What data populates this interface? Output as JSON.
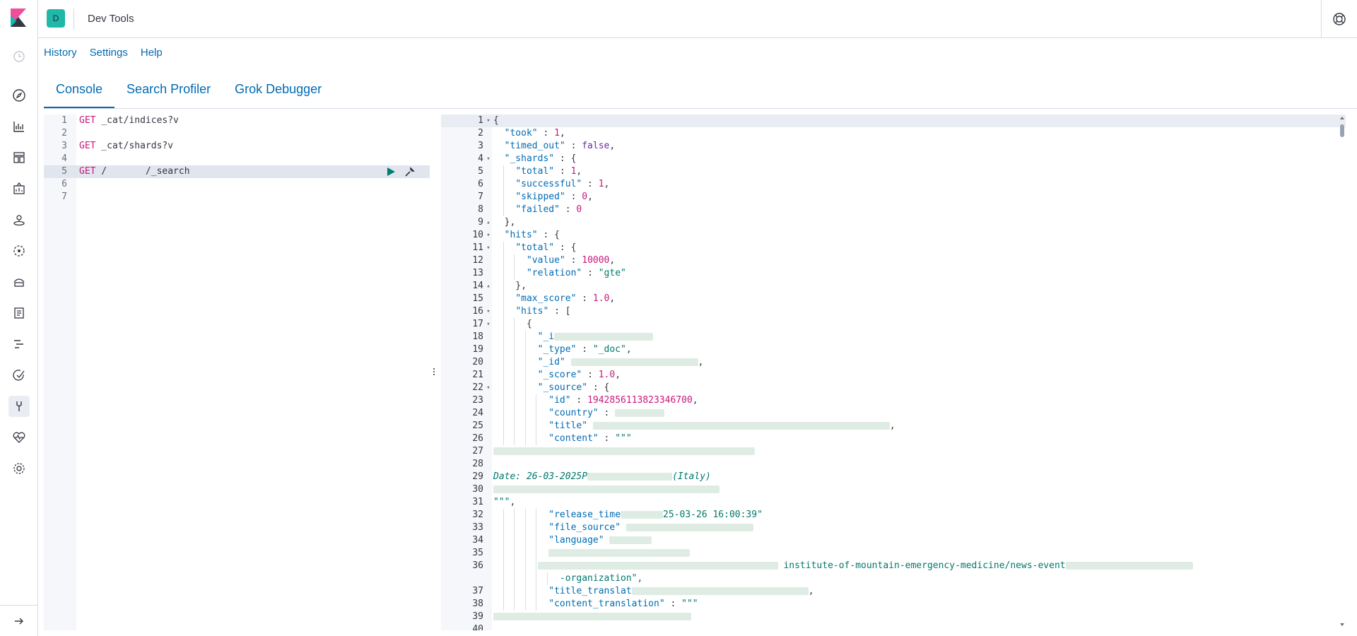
{
  "app": {
    "title": "Dev Tools",
    "space_initial": "D"
  },
  "top_menu": [
    "History",
    "Settings",
    "Help"
  ],
  "tabs": [
    "Console",
    "Search Profiler",
    "Grok Debugger"
  ],
  "request_lines": [
    {
      "n": "1",
      "method": "GET",
      "path": " _cat/indices?v"
    },
    {
      "n": "2",
      "method": "",
      "path": ""
    },
    {
      "n": "3",
      "method": "GET",
      "path": " _cat/shards?v"
    },
    {
      "n": "4",
      "method": "",
      "path": ""
    },
    {
      "n": "5",
      "method": "GET",
      "path": " /       /_search"
    },
    {
      "n": "6",
      "method": "",
      "path": ""
    },
    {
      "n": "7",
      "method": "",
      "path": ""
    }
  ],
  "response": {
    "line_numbers": [
      "1",
      "2",
      "3",
      "4",
      "5",
      "6",
      "7",
      "8",
      "9",
      "10",
      "11",
      "12",
      "13",
      "14",
      "15",
      "16",
      "17",
      "18",
      "19",
      "20",
      "21",
      "22",
      "23",
      "24",
      "25",
      "26",
      "27",
      "28",
      "29",
      "30",
      "31",
      "32",
      "33",
      "34",
      "35",
      "36",
      "",
      "37",
      "38",
      "39",
      "40"
    ],
    "took_key": "\"took\"",
    "took_val": "1",
    "timed_out_key": "\"timed_out\"",
    "timed_out_val": "false",
    "shards_key": "\"_shards\"",
    "total_key": "\"total\"",
    "total_val": "1",
    "successful_key": "\"successful\"",
    "successful_val": "1",
    "skipped_key": "\"skipped\"",
    "skipped_val": "0",
    "failed_key": "\"failed\"",
    "failed_val": "0",
    "hits_key": "\"hits\"",
    "value_key": "\"value\"",
    "value_val": "10000",
    "relation_key": "\"relation\"",
    "relation_val": "\"gte\"",
    "max_score_key": "\"max_score\"",
    "max_score_val": "1.0",
    "index_key_partial": "\"_i",
    "type_key": "\"_type\"",
    "type_val": "\"_doc\"",
    "id_key": "\"_id\"",
    "score_key": "\"_score\"",
    "score_val": "1.0",
    "source_key": "\"_source\"",
    "doc_id_key": "\"id\"",
    "doc_id_val": "1942856113823346700",
    "country_key": "\"country\"",
    "title_key": "\"title\"",
    "content_key": "\"content\"",
    "triple_quote": "\"\"\"",
    "date_prefix": "Date: 26-03-2025P",
    "date_suffix": "(Italy)",
    "release_time_key": "\"release_time",
    "release_time_val": "25-03-26 16:00:39\"",
    "file_source_key": "\"file_source\"",
    "language_key": "\"language\"",
    "url_fragment": "-organization\",",
    "url_mid": "institute-of-mountain-emergency-medicine/news-event",
    "title_translation_key": "\"title_translat",
    "content_translation_key": "\"content_translation\""
  }
}
